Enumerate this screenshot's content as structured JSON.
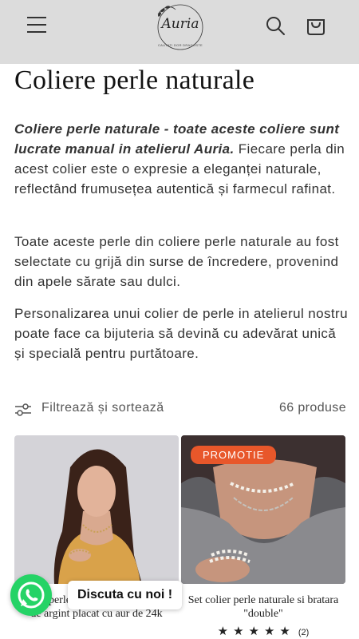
{
  "header": {
    "logo_text": "Auria",
    "logo_tagline": "CAUTATI DOR DRAGOSTE",
    "menu_icon": "hamburger-menu-icon",
    "search_icon": "search-icon",
    "cart_icon": "shopping-bag-icon"
  },
  "collection": {
    "title": "Coliere perle naturale",
    "paragraph1_bold": "Coliere perle naturale - toate aceste coliere sunt lucrate manual in atelierul Auria.",
    "paragraph1_rest": " Fiecare perla din acest colier este o expresie a eleganței naturale, reflectând frumusețea autentică și farmecul rafinat.",
    "paragraph2": "Toate aceste perle din coliere perle naturale au fost selectate cu grijă din surse de încredere, provenind din apele sărate sau dulci.",
    "paragraph3": "Personalizarea unui colier de perle in atelierul nostru poate face ca bijuteria să devină cu adevărat unică și specială pentru purtătoare."
  },
  "filter": {
    "label": "Filtrează și sortează",
    "count": "66 produse",
    "icon": "sliders-icon"
  },
  "products": [
    {
      "title": "Colier perle naturale si Bratara bile de argint placat cu aur de 24k",
      "badge": "",
      "rating_stars": "",
      "rating_count": ""
    },
    {
      "title": "Set colier perle naturale si bratara \"double\"",
      "badge": "PROMOTIE",
      "rating_stars": "★★★★★",
      "rating_count": "(2)"
    }
  ],
  "chat": {
    "label": "Discuta cu noi !",
    "icon": "whatsapp-icon"
  },
  "colors": {
    "header_bg": "#dcdcdc",
    "badge": "#e8572a",
    "whatsapp": "#25d366"
  }
}
